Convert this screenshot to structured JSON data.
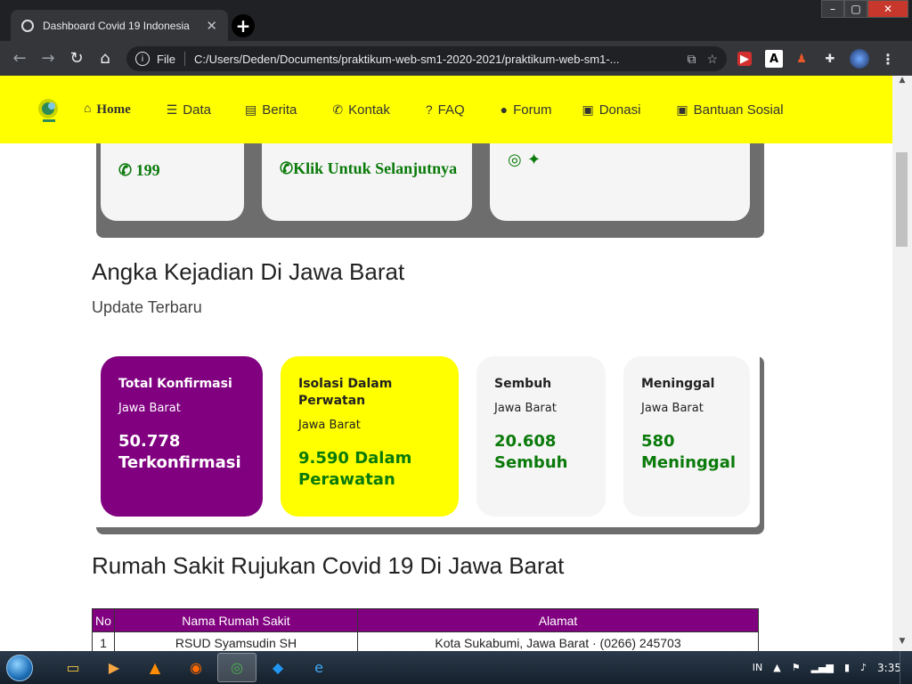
{
  "browser": {
    "tab_title": "Dashboard Covid 19 Indonesia",
    "new_tab": "+",
    "url_scheme": "File",
    "url": "C:/Users/Deden/Documents/praktikum-web-sm1-2020-2021/praktikum-web-sm1-...",
    "window_buttons": {
      "minimize": "–",
      "maximize": "▢",
      "close": "✕"
    }
  },
  "navbar": {
    "items": [
      {
        "label": "Home",
        "icon": "home-icon"
      },
      {
        "label": "Data",
        "icon": "database-icon"
      },
      {
        "label": "Berita",
        "icon": "newspaper-icon"
      },
      {
        "label": "Kontak",
        "icon": "phone-icon"
      },
      {
        "label": "FAQ",
        "icon": "question-icon"
      },
      {
        "label": "Forum",
        "icon": "comment-icon"
      },
      {
        "label": "Donasi",
        "icon": "box-icon"
      },
      {
        "label": "Bantuan Sosial",
        "icon": "box-icon"
      }
    ]
  },
  "top_cards": {
    "hotline": "199",
    "link": "Klik Untuk Selanjutnya"
  },
  "section1": {
    "title": "Angka Kejadian Di Jawa Barat",
    "subtitle": "Update Terbaru"
  },
  "stats": [
    {
      "title": "Total Konfirmasi",
      "region": "Jawa Barat",
      "value": "50.778 Terkonfirmasi",
      "bg": "#800080",
      "fg": "#ffffff",
      "value_color": "#ffffff"
    },
    {
      "title": "Isolasi Dalam Perwatan",
      "region": "Jawa Barat",
      "value": "9.590 Dalam Perawatan",
      "bg": "#ffff00",
      "fg": "#222222",
      "value_color": "#0a7a0a"
    },
    {
      "title": "Sembuh",
      "region": "Jawa Barat",
      "value": "20.608 Sembuh",
      "bg": "#f5f5f5",
      "fg": "#222222",
      "value_color": "#0a7a0a"
    },
    {
      "title": "Meninggal",
      "region": "Jawa Barat",
      "value": "580 Meninggal",
      "bg": "#f5f5f5",
      "fg": "#222222",
      "value_color": "#0a7a0a"
    }
  ],
  "section2": {
    "title": "Rumah Sakit Rujukan Covid 19 Di Jawa Barat"
  },
  "table": {
    "headers": [
      "No",
      "Nama Rumah Sakit",
      "Alamat"
    ],
    "rows": [
      [
        "1",
        "RSUD Syamsudin SH",
        "Kota Sukabumi, Jawa Barat · (0266) 245703"
      ]
    ]
  },
  "taskbar": {
    "language": "IN",
    "time": "3:35"
  },
  "colors": {
    "navbar": "#ffff00",
    "purple": "#800080",
    "green": "#0a7a0a"
  }
}
